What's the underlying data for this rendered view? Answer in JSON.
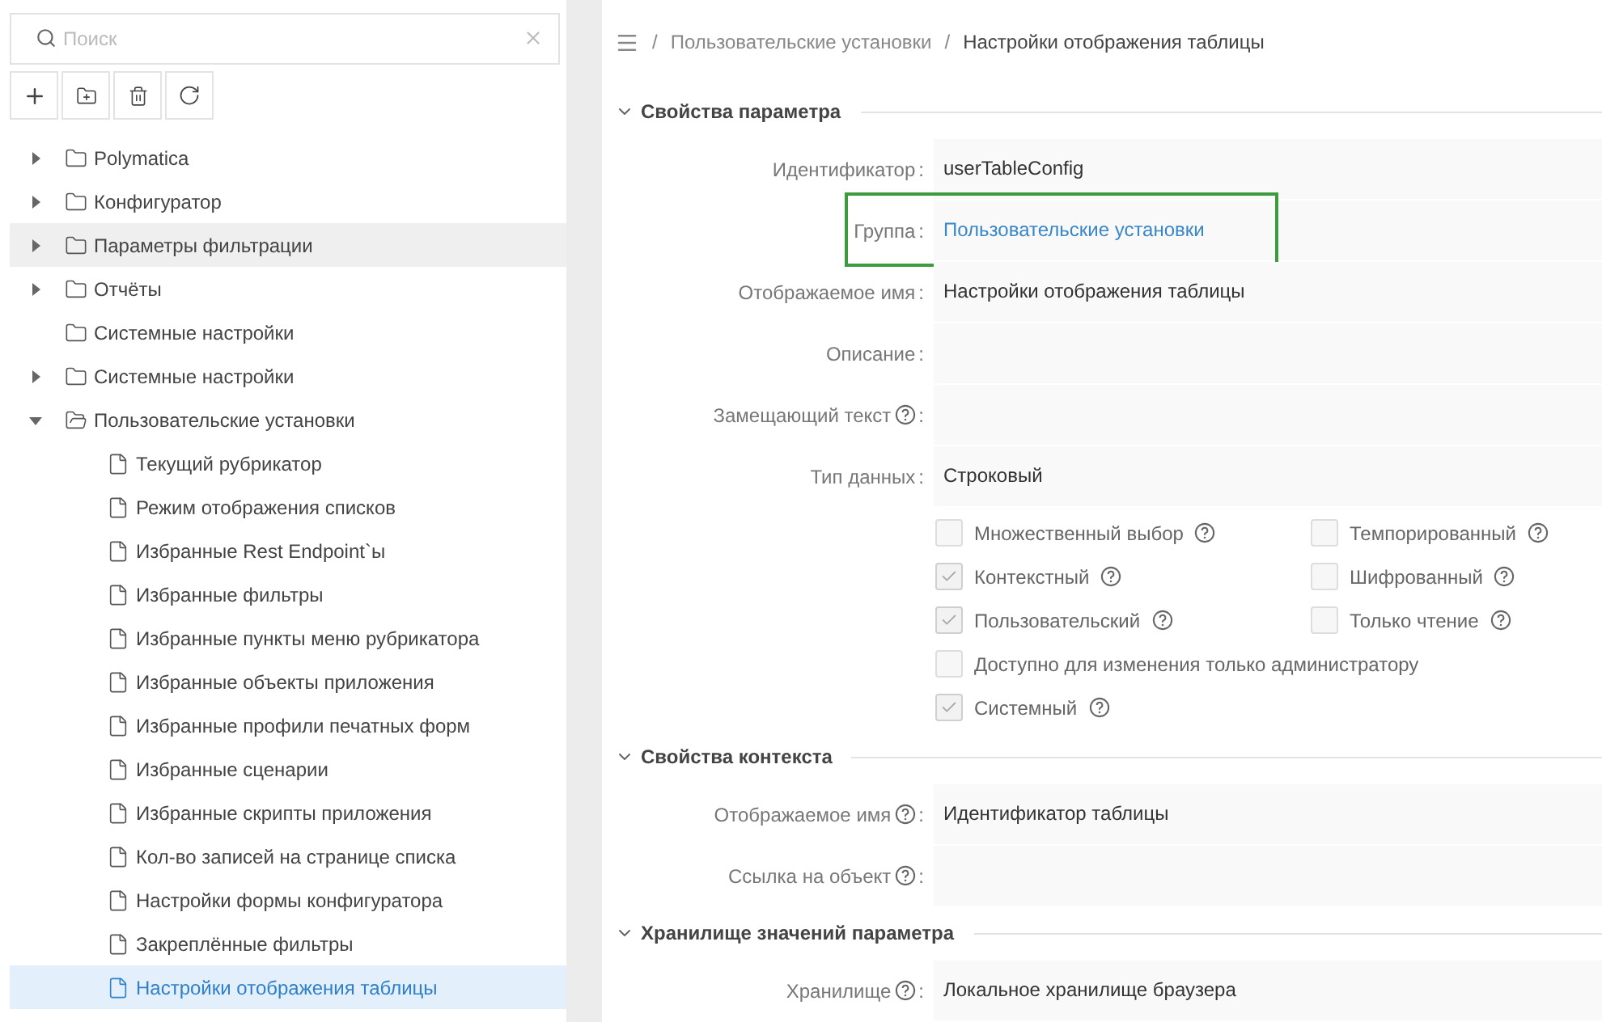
{
  "sidebar": {
    "search": {
      "placeholder": "Поиск"
    },
    "tree": [
      {
        "label": "Polymatica",
        "kind": "folder",
        "expanded": false,
        "selected": false,
        "hovered": false
      },
      {
        "label": "Конфигуратор",
        "kind": "folder",
        "expanded": false,
        "selected": false,
        "hovered": false
      },
      {
        "label": "Параметры фильтрации",
        "kind": "folder",
        "expanded": false,
        "selected": false,
        "hovered": true
      },
      {
        "label": "Отчёты",
        "kind": "folder",
        "expanded": false,
        "selected": false,
        "hovered": false
      },
      {
        "label": "Системные настройки",
        "kind": "empty-folder",
        "selected": false,
        "hovered": false
      },
      {
        "label": "Системные настройки",
        "kind": "folder",
        "expanded": false,
        "selected": false,
        "hovered": false
      },
      {
        "label": "Пользовательские установки",
        "kind": "folder",
        "expanded": true,
        "selected": false,
        "hovered": false,
        "children": [
          {
            "label": "Текущий рубрикатор",
            "kind": "file",
            "selected": false,
            "hovered": false
          },
          {
            "label": "Режим отображения списков",
            "kind": "file",
            "selected": false,
            "hovered": false
          },
          {
            "label": "Избранные Rest Endpoint`ы",
            "kind": "file",
            "selected": false,
            "hovered": false
          },
          {
            "label": "Избранные фильтры",
            "kind": "file",
            "selected": false,
            "hovered": false
          },
          {
            "label": "Избранные пункты меню рубрикатора",
            "kind": "file",
            "selected": false,
            "hovered": false
          },
          {
            "label": "Избранные объекты приложения",
            "kind": "file",
            "selected": false,
            "hovered": false
          },
          {
            "label": "Избранные профили печатных форм",
            "kind": "file",
            "selected": false,
            "hovered": false
          },
          {
            "label": "Избранные сценарии",
            "kind": "file",
            "selected": false,
            "hovered": false
          },
          {
            "label": "Избранные скрипты приложения",
            "kind": "file",
            "selected": false,
            "hovered": false
          },
          {
            "label": "Кол-во записей на странице списка",
            "kind": "file",
            "selected": false,
            "hovered": false
          },
          {
            "label": "Настройки формы конфигуратора",
            "kind": "file",
            "selected": false,
            "hovered": false
          },
          {
            "label": "Закреплённые фильтры",
            "kind": "file",
            "selected": false,
            "hovered": false
          },
          {
            "label": "Настройки отображения таблицы",
            "kind": "file",
            "selected": true,
            "hovered": false
          }
        ]
      }
    ]
  },
  "breadcrumb": [
    {
      "separator": "/",
      "label": "Пользовательские установки"
    },
    {
      "separator": "/",
      "label": "Настройки отображения таблицы"
    }
  ],
  "sections": [
    {
      "title": "Свойства параметра",
      "expanded": true,
      "fields": [
        {
          "label": "Идентификатор",
          "help": false,
          "colon": ":",
          "value": "userTableConfig",
          "kind": "text",
          "highlighted": false
        },
        {
          "label": "Группа",
          "help": false,
          "colon": ":",
          "value": "Пользовательские установки",
          "kind": "link",
          "highlighted": true
        },
        {
          "label": "Отображаемое имя",
          "help": false,
          "colon": ":",
          "value": "Настройки отображения таблицы",
          "kind": "text",
          "highlighted": false
        },
        {
          "label": "Описание",
          "help": false,
          "colon": ":",
          "highlighted": false
        },
        {
          "label": "Замещающий текст",
          "help": true,
          "colon": ":",
          "highlighted": false
        },
        {
          "label": "Тип данных",
          "help": false,
          "colon": ":",
          "value": "Строковый",
          "kind": "text",
          "highlighted": false
        }
      ],
      "checkbox_rows": [
        [
          {
            "label": "Множественный выбор",
            "help": true,
            "checked": false
          },
          {
            "label": "Темпорированный",
            "help": true,
            "checked": false
          }
        ],
        [
          {
            "label": "Контекстный",
            "help": true,
            "checked": true
          },
          {
            "label": "Шифрованный",
            "help": true,
            "checked": false
          }
        ],
        [
          {
            "label": "Пользовательский",
            "help": true,
            "checked": true
          },
          {
            "label": "Только чтение",
            "help": true,
            "checked": false
          }
        ],
        [
          {
            "label": "Доступно для изменения только администратору",
            "help": false,
            "checked": false
          }
        ],
        [
          {
            "label": "Системный",
            "help": true,
            "checked": true
          }
        ]
      ]
    },
    {
      "title": "Свойства контекста",
      "expanded": true,
      "fields": [
        {
          "label": "Отображаемое имя",
          "help": true,
          "colon": ":",
          "value": "Идентификатор таблицы",
          "kind": "text",
          "highlighted": false
        },
        {
          "label": "Ссылка на объект",
          "help": true,
          "colon": ":",
          "highlighted": false
        }
      ]
    },
    {
      "title": "Хранилище значений параметра",
      "expanded": true,
      "fields": [
        {
          "label": "Хранилище",
          "help": true,
          "colon": ":",
          "value": "Локальное хранилище браузера",
          "kind": "text",
          "highlighted": false
        }
      ]
    }
  ]
}
